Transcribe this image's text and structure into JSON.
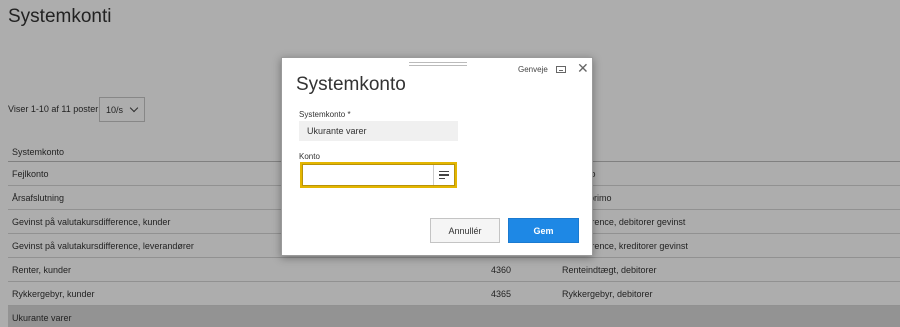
{
  "page": {
    "title": "Systemkonti",
    "pager_text": "Viser 1-10 af 11 poster",
    "page_size": "10/s"
  },
  "table": {
    "header": "Systemkonto",
    "rows": [
      {
        "name": "Fejlkonto",
        "number": "",
        "account": "fejlkonto"
      },
      {
        "name": "Årsafslutning",
        "number": "",
        "account": "konto, primo"
      },
      {
        "name": "Gevinst på valutakursdifference, kunder",
        "number": "",
        "account": "ursdifference, debitorer gevinst"
      },
      {
        "name": "Gevinst på valutakursdifference, leverandører",
        "number": "",
        "account": "ursdifference, kreditorer gevinst"
      },
      {
        "name": "Renter, kunder",
        "number": "4360",
        "account": "Renteindtægt, debitorer"
      },
      {
        "name": "Rykkergebyr, kunder",
        "number": "4365",
        "account": "Rykkergebyr, debitorer"
      },
      {
        "name": "Ukurante varer",
        "number": "",
        "account": ""
      }
    ]
  },
  "modal": {
    "title": "Systemkonto",
    "shortcuts_label": "Genveje",
    "system_account_label": "Systemkonto *",
    "system_account_value": "Ukurante varer",
    "account_label": "Konto",
    "account_value": "",
    "cancel_label": "Annullér",
    "save_label": "Gem"
  },
  "colors": {
    "accent": "#1e88e5",
    "focus": "#e4b600"
  },
  "icons": [
    "close-icon",
    "keyboard-icon",
    "list-icon",
    "chevron-down-icon"
  ]
}
